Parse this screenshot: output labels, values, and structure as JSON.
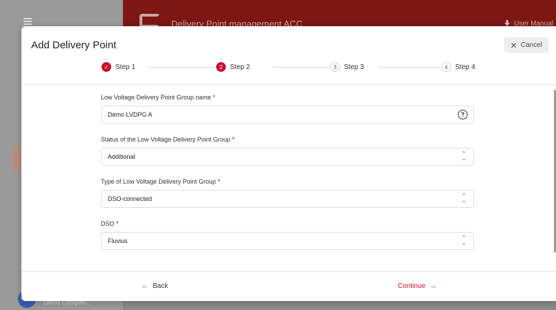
{
  "background": {
    "app_title": "Delivery Point management ACC",
    "user_manual_label": "User Manual",
    "company_label": "Demo Compan..."
  },
  "modal": {
    "title": "Add Delivery Point",
    "cancel_label": "Cancel",
    "steps": [
      {
        "number": "1",
        "label": "Step 1",
        "state": "done"
      },
      {
        "number": "2",
        "label": "Step 2",
        "state": "active"
      },
      {
        "number": "3",
        "label": "Step 3",
        "state": "todo"
      },
      {
        "number": "4",
        "label": "Step 4",
        "state": "todo"
      }
    ],
    "fields": {
      "group_name": {
        "label": "Low Voltage Delivery Point Group name *",
        "value": "Demo LVDPG A"
      },
      "status": {
        "label": "Status of the Low Voltage Delivery Point Group *",
        "value": "Additional"
      },
      "type": {
        "label": "Type of Low Voltage Delivery Point Group *",
        "value": "DSO-connected"
      },
      "dso": {
        "label": "DSO *",
        "value": "Fluvius"
      }
    },
    "back_label": "Back",
    "continue_label": "Continue"
  },
  "colors": {
    "accent": "#c8102e",
    "header_bg": "#7d1714"
  },
  "icons": {
    "cancel": "close-icon",
    "help": "help-circle-icon",
    "select": "chevron-up-down-icon",
    "back": "arrow-left-icon",
    "continue": "arrow-right-icon",
    "step_done": "check-circle-icon"
  }
}
